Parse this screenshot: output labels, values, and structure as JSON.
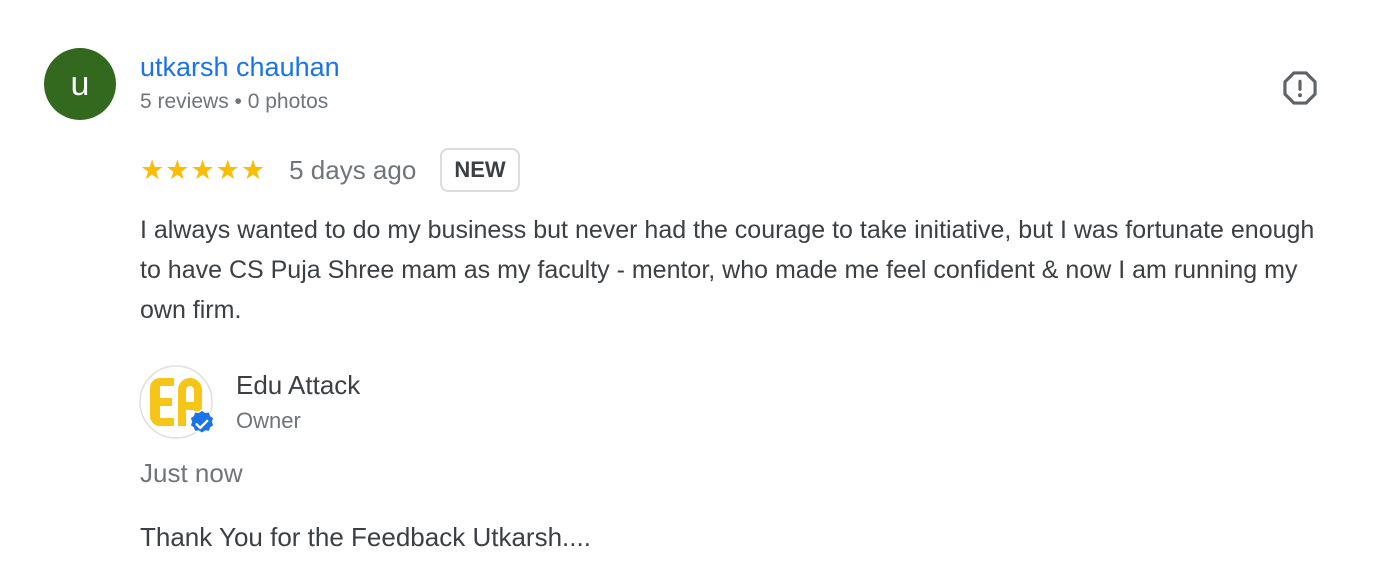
{
  "review": {
    "reviewer": {
      "initial": "u",
      "name": "utkarsh chauhan",
      "meta": "5 reviews • 0 photos",
      "avatar_color": "#33691e"
    },
    "rating": 5,
    "stars": [
      "★",
      "★",
      "★",
      "★",
      "★"
    ],
    "star_color": "#fbbc04",
    "date": "5 days ago",
    "badge": "NEW",
    "text": "I always wanted to do my business but never had the courage to take initiative, but I was fortunate enough to have CS Puja Shree mam as my faculty - mentor, who made me feel confident & now I am running my own firm.",
    "report_icon": "report-icon"
  },
  "response": {
    "owner_name": "Edu Attack",
    "owner_role": "Owner",
    "logo_icon": "ea-logo-icon",
    "verified_icon": "verified-check-icon",
    "date": "Just now",
    "text": "Thank You for the Feedback Utkarsh...."
  }
}
